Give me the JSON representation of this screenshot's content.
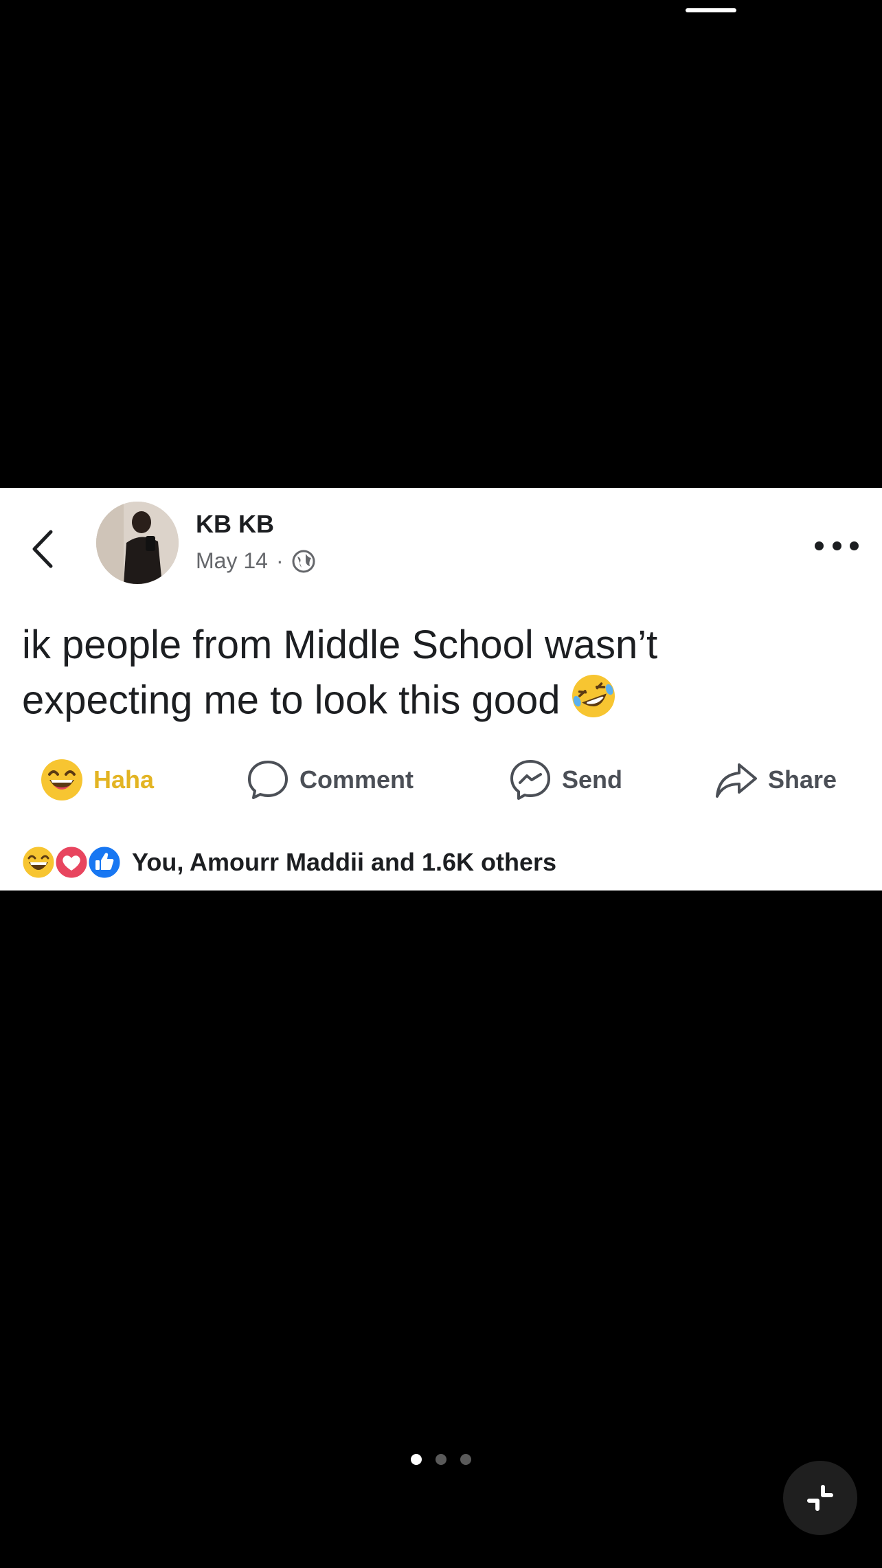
{
  "post": {
    "author": "KB KB",
    "date": "May 14",
    "separator": "·",
    "text_line1": "ik people from Middle School wasn’t",
    "text_line2": "expecting me to look this good"
  },
  "actions": {
    "haha": "Haha",
    "comment": "Comment",
    "send": "Send",
    "share": "Share"
  },
  "reactions": {
    "summary": "You, Amourr Maddii and 1.6K others",
    "icons": [
      "haha-icon",
      "love-icon",
      "like-icon"
    ]
  },
  "pager": {
    "total": 3,
    "active": 1
  },
  "colors": {
    "haha_accent": "#e3b423",
    "like_blue": "#1877f2",
    "love_red": "#e8455f"
  }
}
